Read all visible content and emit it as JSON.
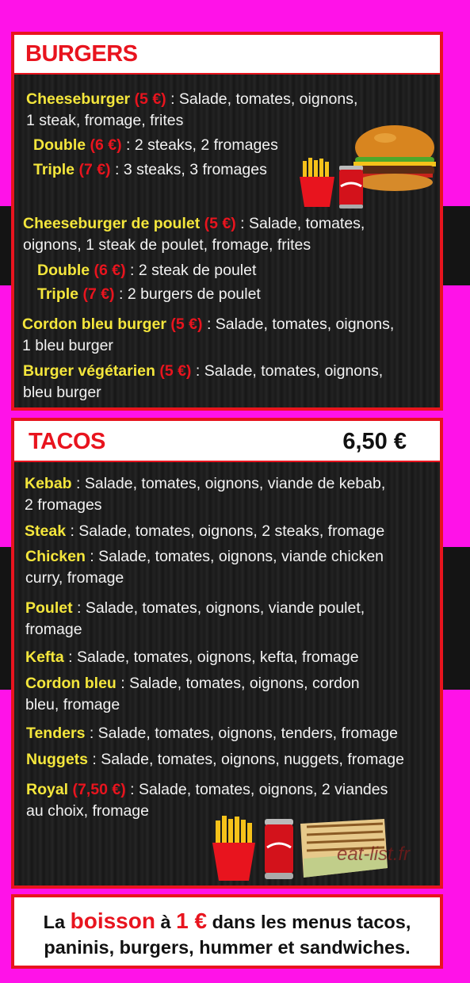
{
  "burgers": {
    "title": "BURGERS",
    "items": [
      {
        "name": "Cheeseburger",
        "price": "(5 €)",
        "desc": " : Salade, tomates, oignons,",
        "desc2": "1 steak, fromage, frites"
      },
      {
        "name": "Double",
        "price": "(6 €)",
        "desc": " : 2 steaks, 2 fromages"
      },
      {
        "name": "Triple",
        "price": "(7 €)",
        "desc": " : 3 steaks, 3 fromages"
      },
      {
        "name": "Cheeseburger de poulet",
        "price": "(5 €)",
        "desc": " : Salade, tomates,",
        "desc2": "oignons, 1 steak de poulet, fromage, frites"
      },
      {
        "name": "Double",
        "price": "(6 €)",
        "desc": " : 2 steak de poulet"
      },
      {
        "name": "Triple",
        "price": "(7 €)",
        "desc": " : 2 burgers de poulet"
      },
      {
        "name": "Cordon bleu burger",
        "price": "(5 €)",
        "desc": " : Salade, tomates, oignons,",
        "desc2": "1 bleu burger"
      },
      {
        "name": "Burger végétarien",
        "price": "(5 €)",
        "desc": " : Salade, tomates, oignons,",
        "desc2": "bleu burger"
      }
    ]
  },
  "tacos": {
    "title": "TACOS",
    "price": "6,50 €",
    "items": [
      {
        "name": "Kebab",
        "desc": " : Salade, tomates, oignons, viande de kebab,",
        "desc2": "2 fromages"
      },
      {
        "name": "Steak",
        "desc": " : Salade, tomates, oignons, 2 steaks, fromage"
      },
      {
        "name": "Chicken",
        "desc": " : Salade, tomates, oignons, viande chicken",
        "desc2": "curry, fromage"
      },
      {
        "name": "Poulet",
        "desc": " : Salade, tomates, oignons, viande poulet,",
        "desc2": "fromage"
      },
      {
        "name": "Kefta",
        "desc": " : Salade, tomates, oignons, kefta, fromage"
      },
      {
        "name": "Cordon bleu",
        "desc": " : Salade, tomates, oignons, cordon",
        "desc2": "bleu, fromage"
      },
      {
        "name": "Tenders",
        "desc": " : Salade, tomates, oignons, tenders, fromage"
      },
      {
        "name": "Nuggets",
        "desc": " : Salade, tomates, oignons, nuggets, fromage"
      },
      {
        "name": "Royal",
        "price": "(7,50 €)",
        "desc": " : Salade, tomates, oignons, 2 viandes",
        "desc2": "au choix, fromage"
      }
    ]
  },
  "footer": {
    "line1_a": "La ",
    "line1_b": "boisson",
    "line1_c": " à ",
    "line1_d": "1 €",
    "line1_e": " dans les menus tacos,",
    "line2": "paninis, burgers, hummer et sandwiches."
  },
  "watermark": "eat-list.fr",
  "images": [
    "burger-image",
    "fries-image",
    "cola-can-image",
    "panini-image"
  ],
  "colors": {
    "background": "#ff12e8",
    "accent": "#e8141e",
    "item_name": "#f4e63c"
  }
}
